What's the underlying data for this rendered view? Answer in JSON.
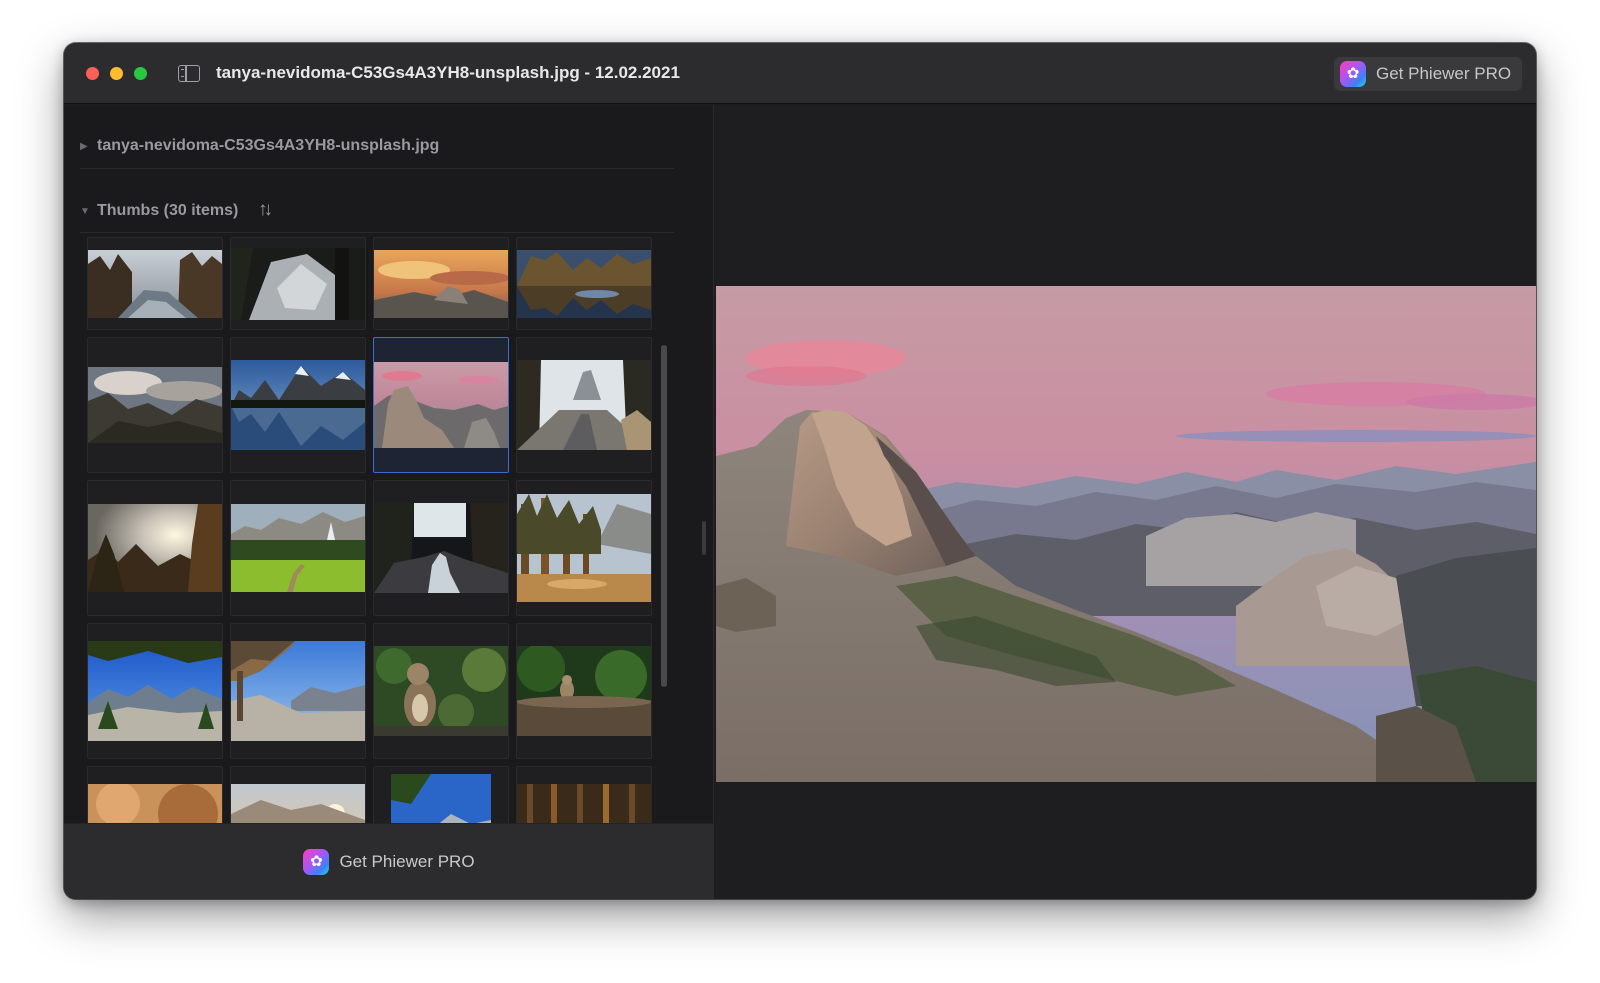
{
  "window": {
    "title": "tanya-nevidoma-C53Gs4A3YH8-unsplash.jpg - 12.02.2021",
    "get_pro_label": "Get Phiewer PRO"
  },
  "sidebar": {
    "file_label": "tanya-nevidoma-C53Gs4A3YH8-unsplash.jpg",
    "thumbs_label": "Thumbs (30 items)",
    "sort_icon": "sort-arrows-icon",
    "selected_index": 6
  },
  "footer": {
    "get_pro_label": "Get Phiewer PRO"
  },
  "colors": {
    "window_bg": "#1c1c1e",
    "titlebar_bg": "#2c2c2e",
    "selection": "#3b6dd6",
    "close": "#fe5f57",
    "minimize": "#febc2e",
    "zoom": "#28c840"
  }
}
